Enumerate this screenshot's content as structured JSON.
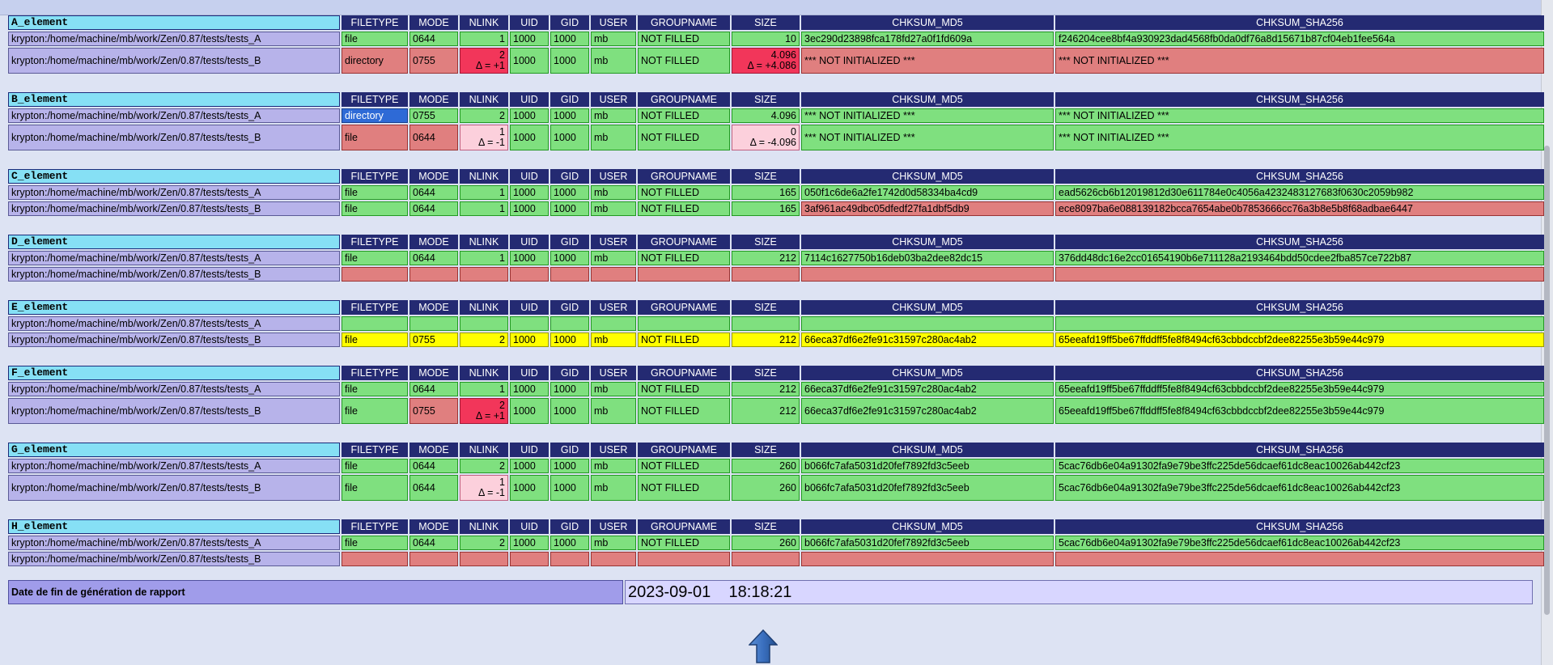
{
  "columns": [
    "FILETYPE",
    "MODE",
    "NLINK",
    "UID",
    "GID",
    "USER",
    "GROUPNAME",
    "SIZE",
    "CHKSUM_MD5",
    "CHKSUM_SHA256"
  ],
  "colors": {
    "match": "#7fe07f",
    "diff": "#e07f7f",
    "new": "#ffff00",
    "strong_diff": "#f2365a",
    "light_diff": "#fcd0dc",
    "type_highlight": "#2e6ad6",
    "path": "#b7b3ea",
    "header": "#242a72",
    "element_name": "#86e0f5"
  },
  "groups": [
    {
      "name": "A_element",
      "rows": [
        {
          "path": "krypton:/home/machine/mb/work/Zen/0.87/tests/tests_A",
          "tall": false,
          "cells": [
            {
              "v": "file",
              "c": "g"
            },
            {
              "v": "0644",
              "c": "g"
            },
            {
              "v": "1",
              "c": "g",
              "n": true
            },
            {
              "v": "1000",
              "c": "g"
            },
            {
              "v": "1000",
              "c": "g"
            },
            {
              "v": "mb",
              "c": "g"
            },
            {
              "v": "NOT FILLED",
              "c": "g"
            },
            {
              "v": "10",
              "c": "g",
              "n": true
            },
            {
              "v": "3ec290d23898fca178fd27a0f1fd609a",
              "c": "g"
            },
            {
              "v": "f246204cee8bf4a930923dad4568fb0da0df76a8d15671b87cf04eb1fee564a",
              "c": "g"
            }
          ]
        },
        {
          "path": "krypton:/home/machine/mb/work/Zen/0.87/tests/tests_B",
          "tall": true,
          "cells": [
            {
              "v": "directory",
              "c": "r"
            },
            {
              "v": "0755",
              "c": "r"
            },
            {
              "v": "2",
              "d": "Δ = +1",
              "c": "rr",
              "n": true
            },
            {
              "v": "1000",
              "c": "g"
            },
            {
              "v": "1000",
              "c": "g"
            },
            {
              "v": "mb",
              "c": "g"
            },
            {
              "v": "NOT FILLED",
              "c": "g"
            },
            {
              "v": "4.096",
              "d": "Δ = +4.086",
              "c": "rr",
              "n": true
            },
            {
              "v": "*** NOT INITIALIZED ***",
              "c": "r"
            },
            {
              "v": "*** NOT INITIALIZED ***",
              "c": "r"
            }
          ]
        }
      ]
    },
    {
      "name": "B_element",
      "rows": [
        {
          "path": "krypton:/home/machine/mb/work/Zen/0.87/tests/tests_A",
          "tall": false,
          "cells": [
            {
              "v": "directory",
              "c": "bl"
            },
            {
              "v": "0755",
              "c": "g"
            },
            {
              "v": "2",
              "c": "g",
              "n": true
            },
            {
              "v": "1000",
              "c": "g"
            },
            {
              "v": "1000",
              "c": "g"
            },
            {
              "v": "mb",
              "c": "g"
            },
            {
              "v": "NOT FILLED",
              "c": "g"
            },
            {
              "v": "4.096",
              "c": "g",
              "n": true
            },
            {
              "v": "*** NOT INITIALIZED ***",
              "c": "g"
            },
            {
              "v": "*** NOT INITIALIZED ***",
              "c": "g"
            }
          ]
        },
        {
          "path": "krypton:/home/machine/mb/work/Zen/0.87/tests/tests_B",
          "tall": true,
          "cells": [
            {
              "v": "file",
              "c": "r"
            },
            {
              "v": "0644",
              "c": "r"
            },
            {
              "v": "1",
              "d": "Δ = -1",
              "c": "pk",
              "n": true
            },
            {
              "v": "1000",
              "c": "g"
            },
            {
              "v": "1000",
              "c": "g"
            },
            {
              "v": "mb",
              "c": "g"
            },
            {
              "v": "NOT FILLED",
              "c": "g"
            },
            {
              "v": "0",
              "d": "Δ = -4.096",
              "c": "pk",
              "n": true
            },
            {
              "v": "*** NOT INITIALIZED ***",
              "c": "g"
            },
            {
              "v": "*** NOT INITIALIZED ***",
              "c": "g"
            }
          ]
        }
      ]
    },
    {
      "name": "C_element",
      "rows": [
        {
          "path": "krypton:/home/machine/mb/work/Zen/0.87/tests/tests_A",
          "tall": false,
          "cells": [
            {
              "v": "file",
              "c": "g"
            },
            {
              "v": "0644",
              "c": "g"
            },
            {
              "v": "1",
              "c": "g",
              "n": true
            },
            {
              "v": "1000",
              "c": "g"
            },
            {
              "v": "1000",
              "c": "g"
            },
            {
              "v": "mb",
              "c": "g"
            },
            {
              "v": "NOT FILLED",
              "c": "g"
            },
            {
              "v": "165",
              "c": "g",
              "n": true
            },
            {
              "v": "050f1c6de6a2fe1742d0d58334ba4cd9",
              "c": "g"
            },
            {
              "v": "ead5626cb6b12019812d30e611784e0c4056a4232483127683f0630c2059b982",
              "c": "g"
            }
          ]
        },
        {
          "path": "krypton:/home/machine/mb/work/Zen/0.87/tests/tests_B",
          "tall": false,
          "cells": [
            {
              "v": "file",
              "c": "g"
            },
            {
              "v": "0644",
              "c": "g"
            },
            {
              "v": "1",
              "c": "g",
              "n": true
            },
            {
              "v": "1000",
              "c": "g"
            },
            {
              "v": "1000",
              "c": "g"
            },
            {
              "v": "mb",
              "c": "g"
            },
            {
              "v": "NOT FILLED",
              "c": "g"
            },
            {
              "v": "165",
              "c": "g",
              "n": true
            },
            {
              "v": "3af961ac49dbc05dfedf27fa1dbf5db9",
              "c": "r"
            },
            {
              "v": "ece8097ba6e088139182bcca7654abe0b7853666cc76a3b8e5b8f68adbae6447",
              "c": "r"
            }
          ]
        }
      ]
    },
    {
      "name": "D_element",
      "rows": [
        {
          "path": "krypton:/home/machine/mb/work/Zen/0.87/tests/tests_A",
          "tall": false,
          "cells": [
            {
              "v": "file",
              "c": "g"
            },
            {
              "v": "0644",
              "c": "g"
            },
            {
              "v": "1",
              "c": "g",
              "n": true
            },
            {
              "v": "1000",
              "c": "g"
            },
            {
              "v": "1000",
              "c": "g"
            },
            {
              "v": "mb",
              "c": "g"
            },
            {
              "v": "NOT FILLED",
              "c": "g"
            },
            {
              "v": "212",
              "c": "g",
              "n": true
            },
            {
              "v": "7114c1627750b16deb03ba2dee82dc15",
              "c": "g"
            },
            {
              "v": "376dd48dc16e2cc01654190b6e711128a2193464bdd50cdee2fba857ce722b87",
              "c": "g"
            }
          ]
        },
        {
          "path": "krypton:/home/machine/mb/work/Zen/0.87/tests/tests_B",
          "tall": false,
          "cells": [
            {
              "v": "",
              "c": "r"
            },
            {
              "v": "",
              "c": "r"
            },
            {
              "v": "",
              "c": "r"
            },
            {
              "v": "",
              "c": "r"
            },
            {
              "v": "",
              "c": "r"
            },
            {
              "v": "",
              "c": "r"
            },
            {
              "v": "",
              "c": "r"
            },
            {
              "v": "",
              "c": "r"
            },
            {
              "v": "",
              "c": "r"
            },
            {
              "v": "",
              "c": "r"
            }
          ]
        }
      ]
    },
    {
      "name": "E_element",
      "rows": [
        {
          "path": "krypton:/home/machine/mb/work/Zen/0.87/tests/tests_A",
          "tall": false,
          "cells": [
            {
              "v": "",
              "c": "g"
            },
            {
              "v": "",
              "c": "g"
            },
            {
              "v": "",
              "c": "g"
            },
            {
              "v": "",
              "c": "g"
            },
            {
              "v": "",
              "c": "g"
            },
            {
              "v": "",
              "c": "g"
            },
            {
              "v": "",
              "c": "g"
            },
            {
              "v": "",
              "c": "g"
            },
            {
              "v": "",
              "c": "g"
            },
            {
              "v": "",
              "c": "g"
            }
          ]
        },
        {
          "path": "krypton:/home/machine/mb/work/Zen/0.87/tests/tests_B",
          "tall": false,
          "cells": [
            {
              "v": "file",
              "c": "y"
            },
            {
              "v": "0755",
              "c": "y"
            },
            {
              "v": "2",
              "c": "y",
              "n": true
            },
            {
              "v": "1000",
              "c": "y"
            },
            {
              "v": "1000",
              "c": "y"
            },
            {
              "v": "mb",
              "c": "y"
            },
            {
              "v": "NOT FILLED",
              "c": "y"
            },
            {
              "v": "212",
              "c": "y",
              "n": true
            },
            {
              "v": "66eca37df6e2fe91c31597c280ac4ab2",
              "c": "y"
            },
            {
              "v": "65eeafd19ff5be67ffddff5fe8f8494cf63cbbdccbf2dee82255e3b59e44c979",
              "c": "y"
            }
          ]
        }
      ]
    },
    {
      "name": "F_element",
      "rows": [
        {
          "path": "krypton:/home/machine/mb/work/Zen/0.87/tests/tests_A",
          "tall": false,
          "cells": [
            {
              "v": "file",
              "c": "g"
            },
            {
              "v": "0644",
              "c": "g"
            },
            {
              "v": "1",
              "c": "g",
              "n": true
            },
            {
              "v": "1000",
              "c": "g"
            },
            {
              "v": "1000",
              "c": "g"
            },
            {
              "v": "mb",
              "c": "g"
            },
            {
              "v": "NOT FILLED",
              "c": "g"
            },
            {
              "v": "212",
              "c": "g",
              "n": true
            },
            {
              "v": "66eca37df6e2fe91c31597c280ac4ab2",
              "c": "g"
            },
            {
              "v": "65eeafd19ff5be67ffddff5fe8f8494cf63cbbdccbf2dee82255e3b59e44c979",
              "c": "g"
            }
          ]
        },
        {
          "path": "krypton:/home/machine/mb/work/Zen/0.87/tests/tests_B",
          "tall": true,
          "cells": [
            {
              "v": "file",
              "c": "g"
            },
            {
              "v": "0755",
              "c": "r"
            },
            {
              "v": "2",
              "d": "Δ = +1",
              "c": "rr",
              "n": true
            },
            {
              "v": "1000",
              "c": "g"
            },
            {
              "v": "1000",
              "c": "g"
            },
            {
              "v": "mb",
              "c": "g"
            },
            {
              "v": "NOT FILLED",
              "c": "g"
            },
            {
              "v": "212",
              "c": "g",
              "n": true
            },
            {
              "v": "66eca37df6e2fe91c31597c280ac4ab2",
              "c": "g"
            },
            {
              "v": "65eeafd19ff5be67ffddff5fe8f8494cf63cbbdccbf2dee82255e3b59e44c979",
              "c": "g"
            }
          ]
        }
      ]
    },
    {
      "name": "G_element",
      "rows": [
        {
          "path": "krypton:/home/machine/mb/work/Zen/0.87/tests/tests_A",
          "tall": false,
          "cells": [
            {
              "v": "file",
              "c": "g"
            },
            {
              "v": "0644",
              "c": "g"
            },
            {
              "v": "2",
              "c": "g",
              "n": true
            },
            {
              "v": "1000",
              "c": "g"
            },
            {
              "v": "1000",
              "c": "g"
            },
            {
              "v": "mb",
              "c": "g"
            },
            {
              "v": "NOT FILLED",
              "c": "g"
            },
            {
              "v": "260",
              "c": "g",
              "n": true
            },
            {
              "v": "b066fc7afa5031d20fef7892fd3c5eeb",
              "c": "g"
            },
            {
              "v": "5cac76db6e04a91302fa9e79be3ffc225de56dcaef61dc8eac10026ab442cf23",
              "c": "g"
            }
          ]
        },
        {
          "path": "krypton:/home/machine/mb/work/Zen/0.87/tests/tests_B",
          "tall": true,
          "cells": [
            {
              "v": "file",
              "c": "g"
            },
            {
              "v": "0644",
              "c": "g"
            },
            {
              "v": "1",
              "d": "Δ = -1",
              "c": "pk",
              "n": true
            },
            {
              "v": "1000",
              "c": "g"
            },
            {
              "v": "1000",
              "c": "g"
            },
            {
              "v": "mb",
              "c": "g"
            },
            {
              "v": "NOT FILLED",
              "c": "g"
            },
            {
              "v": "260",
              "c": "g",
              "n": true
            },
            {
              "v": "b066fc7afa5031d20fef7892fd3c5eeb",
              "c": "g"
            },
            {
              "v": "5cac76db6e04a91302fa9e79be3ffc225de56dcaef61dc8eac10026ab442cf23",
              "c": "g"
            }
          ]
        }
      ]
    },
    {
      "name": "H_element",
      "rows": [
        {
          "path": "krypton:/home/machine/mb/work/Zen/0.87/tests/tests_A",
          "tall": false,
          "cells": [
            {
              "v": "file",
              "c": "g"
            },
            {
              "v": "0644",
              "c": "g"
            },
            {
              "v": "2",
              "c": "g",
              "n": true
            },
            {
              "v": "1000",
              "c": "g"
            },
            {
              "v": "1000",
              "c": "g"
            },
            {
              "v": "mb",
              "c": "g"
            },
            {
              "v": "NOT FILLED",
              "c": "g"
            },
            {
              "v": "260",
              "c": "g",
              "n": true
            },
            {
              "v": "b066fc7afa5031d20fef7892fd3c5eeb",
              "c": "g"
            },
            {
              "v": "5cac76db6e04a91302fa9e79be3ffc225de56dcaef61dc8eac10026ab442cf23",
              "c": "g"
            }
          ]
        },
        {
          "path": "krypton:/home/machine/mb/work/Zen/0.87/tests/tests_B",
          "tall": false,
          "cells": [
            {
              "v": "",
              "c": "r"
            },
            {
              "v": "",
              "c": "r"
            },
            {
              "v": "",
              "c": "r"
            },
            {
              "v": "",
              "c": "r"
            },
            {
              "v": "",
              "c": "r"
            },
            {
              "v": "",
              "c": "r"
            },
            {
              "v": "",
              "c": "r"
            },
            {
              "v": "",
              "c": "r"
            },
            {
              "v": "",
              "c": "r"
            },
            {
              "v": "",
              "c": "r"
            }
          ]
        }
      ]
    }
  ],
  "footer": {
    "label": "Date de fin de génération de rapport",
    "value": "2023-09-01    18:18:21"
  },
  "scroll_top_icon": "up-arrow-icon"
}
